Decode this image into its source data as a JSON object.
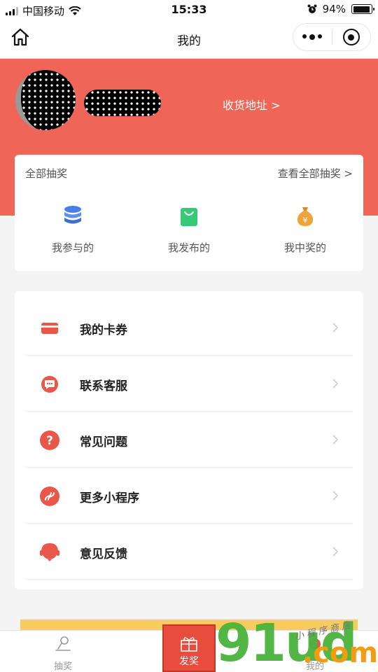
{
  "status_bar": {
    "carrier": "中国移动",
    "time": "15:33",
    "battery": "94%",
    "battery_level": 0.94
  },
  "nav": {
    "title": "我的"
  },
  "profile": {
    "address_link": "收货地址 >"
  },
  "lottery": {
    "title": "全部抽奖",
    "view_all": "查看全部抽奖 >",
    "items": [
      {
        "label": "我参与的",
        "icon": "database-stack-icon",
        "color": "#4a7fe8"
      },
      {
        "label": "我发布的",
        "icon": "shopping-bag-icon",
        "color": "#37c976"
      },
      {
        "label": "我中奖的",
        "icon": "money-bag-icon",
        "color": "#f0a53a"
      }
    ]
  },
  "menu": [
    {
      "label": "我的卡券",
      "icon": "card-icon"
    },
    {
      "label": "联系客服",
      "icon": "chat-bubble-icon"
    },
    {
      "label": "常见问题",
      "icon": "question-icon"
    },
    {
      "label": "更多小程序",
      "icon": "link-icon"
    },
    {
      "label": "意见反馈",
      "icon": "headset-icon"
    }
  ],
  "colors": {
    "brand_red": "#ef6659",
    "icon_red": "#e8574a"
  },
  "tabbar": {
    "tabs": [
      {
        "label": "抽奖"
      },
      {
        "label": "发奖"
      },
      {
        "label": "我的"
      }
    ]
  },
  "watermark": {
    "big": "91ud",
    "com": ".com",
    "small": "小程序商店"
  }
}
